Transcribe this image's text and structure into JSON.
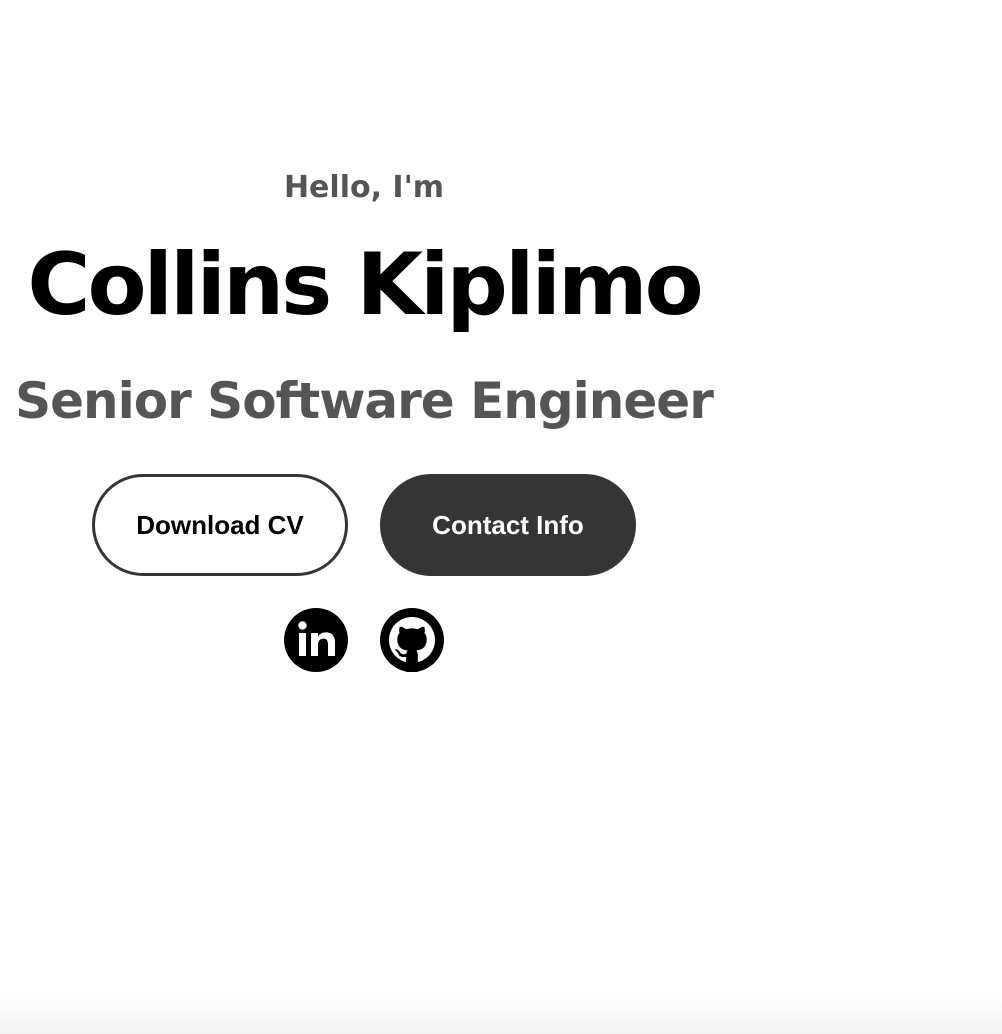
{
  "hero": {
    "greeting": "Hello, I'm",
    "name": "Collins Kiplimo",
    "title": "Senior Software Engineer"
  },
  "buttons": {
    "download_cv": "Download CV",
    "contact_info": "Contact Info"
  },
  "social": [
    {
      "icon": "linkedin-icon"
    },
    {
      "icon": "github-icon"
    }
  ],
  "colors": {
    "text_primary": "#000000",
    "text_secondary": "#555555",
    "button_dark": "#353535",
    "background": "#ffffff"
  }
}
